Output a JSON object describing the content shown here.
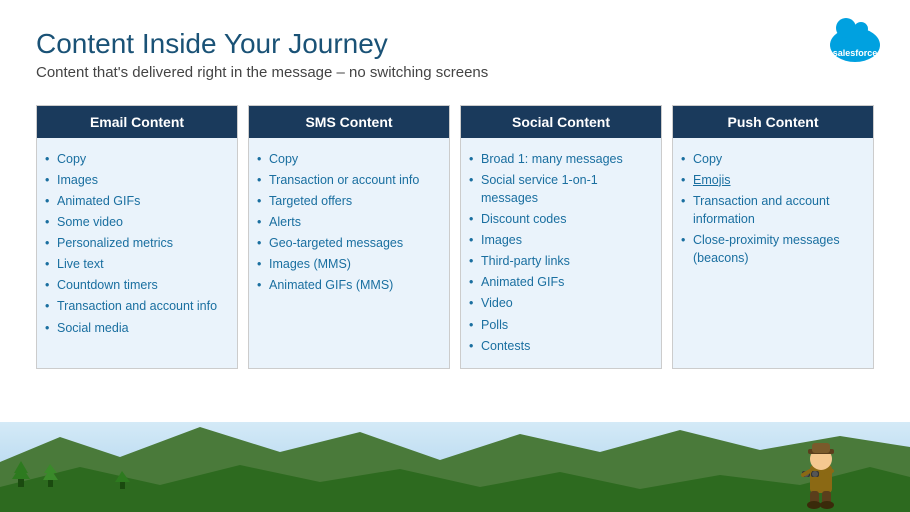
{
  "page": {
    "title": "Content Inside Your Journey",
    "subtitle": "Content that's delivered right in the message – no switching screens"
  },
  "columns": [
    {
      "id": "email",
      "header": "Email Content",
      "items": [
        "Copy",
        "Images",
        "Animated GIFs",
        "Some video",
        "Personalized metrics",
        "Live text",
        "Countdown timers",
        "Transaction and account info",
        "Social media"
      ]
    },
    {
      "id": "sms",
      "header": "SMS Content",
      "items": [
        "Copy",
        "Transaction or account info",
        "Targeted offers",
        "Alerts",
        "Geo-targeted messages",
        "Images (MMS)",
        "Animated GIFs (MMS)"
      ]
    },
    {
      "id": "social",
      "header": "Social Content",
      "items": [
        "Broad 1: many messages",
        "Social service 1-on-1 messages",
        "Discount codes",
        "Images",
        "Third-party links",
        "Animated GIFs",
        "Video",
        "Polls",
        "Contests"
      ]
    },
    {
      "id": "push",
      "header": "Push Content",
      "items": [
        "Copy",
        "Emojis",
        "Transaction and account information",
        "Close-proximity messages (beacons)"
      ]
    }
  ],
  "logo": {
    "text": "salesforce"
  }
}
